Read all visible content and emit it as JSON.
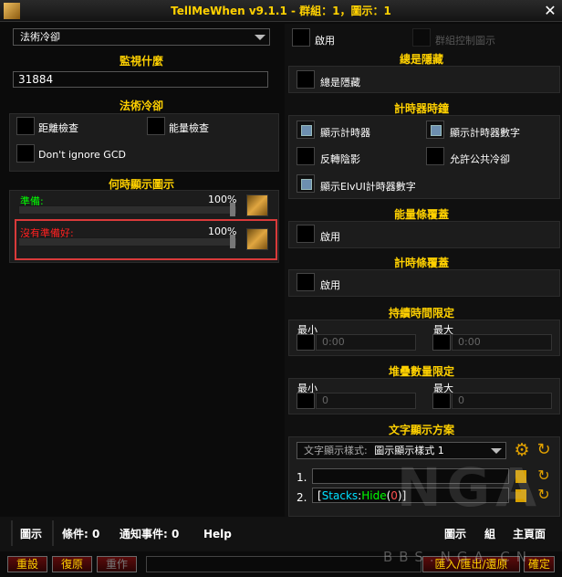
{
  "window": {
    "title": "TellMeWhen v9.1.1  - 群組：1，圖示：1"
  },
  "left": {
    "type_dropdown": "法術冷卻",
    "what_heading": "監視什麼",
    "spell_value": "31884",
    "cooldown_heading": "法術冷卻",
    "range_check": "距離檢查",
    "power_check": "能量檢查",
    "ignore_gcd": "Don't ignore GCD",
    "show_when_heading": "何時顯示圖示",
    "ready_label": "準備:",
    "ready_pct": "100%",
    "not_ready_label": "沒有準備好:",
    "not_ready_pct": "100%"
  },
  "right": {
    "enable": "啟用",
    "group_control": "群組控制圖示",
    "always_hide_heading": "總是隱藏",
    "always_hide": "總是隱藏",
    "timer_heading": "計時器時鐘",
    "show_timer": "顯示計時器",
    "show_timer_text": "顯示計時器數字",
    "reverse_shading": "反轉陰影",
    "allow_gcd": "允許公共冷卻",
    "show_elvui_text": "顯示ElvUI計時器數字",
    "power_bar_heading": "能量條覆蓋",
    "power_bar_enable": "啟用",
    "timer_bar_heading": "計時條覆蓋",
    "timer_bar_enable": "啟用",
    "duration_heading": "持續時間限定",
    "duration_min_label": "最小",
    "duration_max_label": "最大",
    "duration_min_value": "0:00",
    "duration_max_value": "0:00",
    "stack_heading": "堆疊數量限定",
    "stack_min_label": "最小",
    "stack_max_label": "最大",
    "stack_min_value": "0",
    "stack_max_value": "0",
    "text_heading": "文字顯示方案",
    "text_layout_prefix": "文字顯示樣式:",
    "text_layout_value": "圖示顯示樣式 1",
    "line1_num": "1.",
    "line1_value": "",
    "line2_num": "2.",
    "line2_open": "[",
    "line2_stacks": "Stacks",
    "line2_colon": ":",
    "line2_hide": "Hide",
    "line2_paren_open": "(",
    "line2_zero": "0",
    "line2_close": ")]"
  },
  "tabs": {
    "icon": "圖示",
    "conditions": "條件: 0",
    "notifications": "通知事件: 0",
    "help": "Help",
    "right_icon": "圖示",
    "right_group": "組",
    "right_main": "主頁面"
  },
  "bottom": {
    "reset": "重設",
    "restore": "復原",
    "redo": "重作",
    "import_export": "匯入/匯出/還原",
    "ok": "確定"
  },
  "watermark": {
    "site": "BBS.NGA.CN",
    "logo": "NGA"
  },
  "colors": {
    "gold": "#ffd100",
    "green": "#00ff00",
    "red": "#ff2020",
    "highlight": "#d93a3a",
    "cyan": "#00e0ff"
  }
}
